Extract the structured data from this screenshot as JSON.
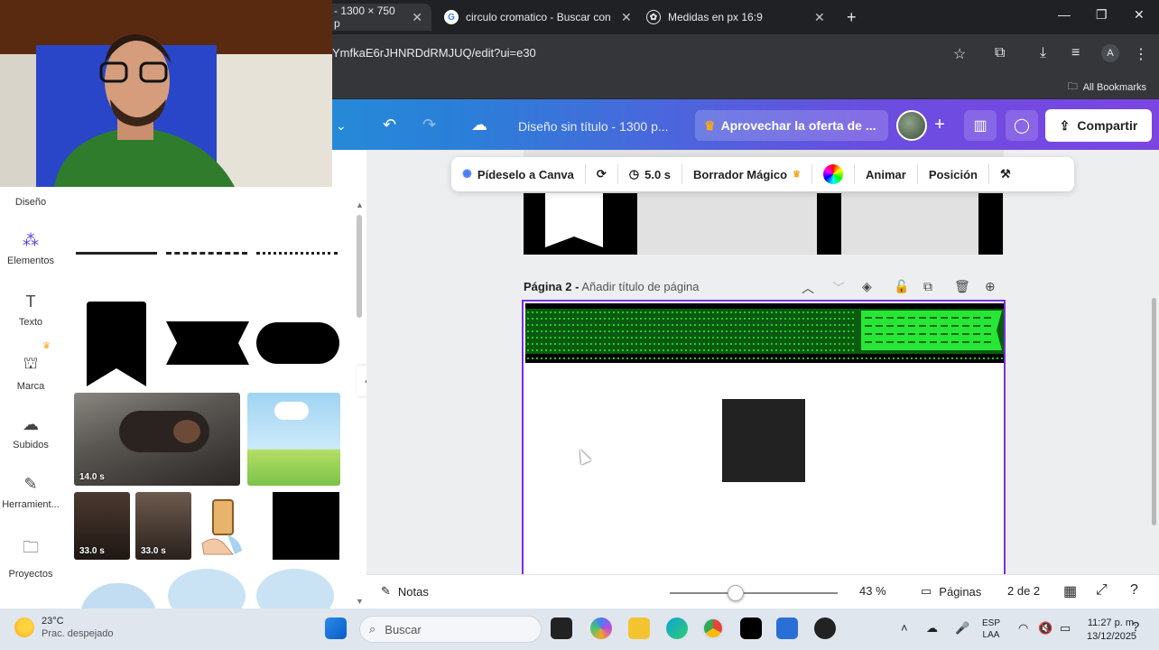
{
  "browser": {
    "tabs": [
      {
        "title": "- 1300 × 750 p",
        "active": true
      },
      {
        "title": "circulo cromatico - Buscar con G",
        "active": false
      },
      {
        "title": "Medidas en px 16:9",
        "active": false
      }
    ],
    "new_tab_label": "+",
    "url": "YmfkaE6rJHNRDdRMJUQ/edit?ui=e30",
    "profile_initial": "A",
    "all_bookmarks": "All Bookmarks"
  },
  "canva_header": {
    "doc_title": "Diseño sin título - 1300 p...",
    "offer_label": "Aprovechar la oferta de ...",
    "share_label": "Compartir"
  },
  "rail": {
    "items": [
      {
        "label": "Diseño",
        "icon": "design-icon"
      },
      {
        "label": "Elementos",
        "icon": "elements-icon"
      },
      {
        "label": "Texto",
        "icon": "text-icon"
      },
      {
        "label": "Marca",
        "icon": "brand-icon"
      },
      {
        "label": "Subidos",
        "icon": "upload-icon"
      },
      {
        "label": "Herramient...",
        "icon": "tools-icon"
      },
      {
        "label": "Proyectos",
        "icon": "projects-icon"
      }
    ]
  },
  "panel": {
    "video_durations": [
      "14.0 s",
      "33.0 s",
      "33.0 s"
    ]
  },
  "floating_toolbar": {
    "ask_canva": "Pídeselo a Canva",
    "duration": "5.0 s",
    "magic_eraser": "Borrador Mágico",
    "animate": "Animar",
    "position": "Posición"
  },
  "page2": {
    "label_prefix": "Página 2 -",
    "label_title": "Añadir título de página"
  },
  "bottombar": {
    "notes": "Notas",
    "zoom": "43 %",
    "zoom_level": 0.43,
    "pages": "Páginas",
    "page_count": "2 de 2"
  },
  "taskbar": {
    "temperature": "23°C",
    "weather": "Prac. despejado",
    "search_placeholder": "Buscar",
    "lang_top": "ESP",
    "lang_bottom": "LAA",
    "time": "11:27 p. m.",
    "date": "13/12/2025"
  },
  "colors": {
    "accent": "#7b45e3",
    "page_border": "#7a2ee0",
    "banner_green": "#19d128"
  }
}
